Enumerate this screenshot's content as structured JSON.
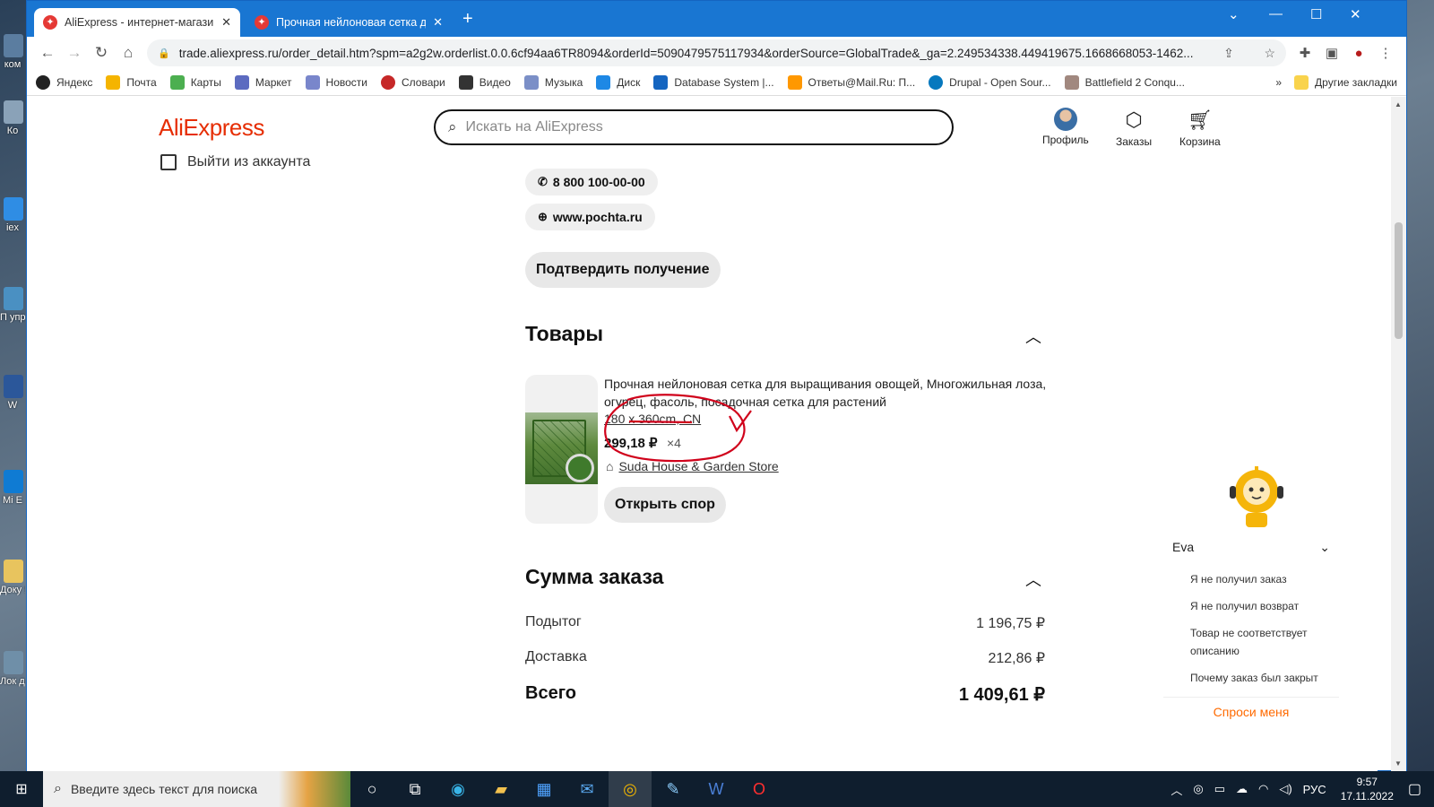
{
  "desktop": {
    "icons": [
      "ком",
      "Ко",
      "iex",
      "П упра",
      "W",
      "Mi E",
      "Доку Я",
      "Лок дис"
    ]
  },
  "browser": {
    "tabs": [
      {
        "title": "AliExpress - интернет-магазин э",
        "active": true
      },
      {
        "title": "Прочная нейлоновая сетка для",
        "active": false
      }
    ],
    "url": "trade.aliexpress.ru/order_detail.htm?spm=a2g2w.orderlist.0.0.6cf94aa6TR8094&orderId=5090479575117934&orderSource=GlobalTrade&_ga=2.249534338.449419675.1668668053-1462...",
    "bookmarks": [
      "Яндекс",
      "Почта",
      "Карты",
      "Маркет",
      "Новости",
      "Словари",
      "Видео",
      "Музыка",
      "Диск",
      "Database System |...",
      "Ответы@Mail.Ru: П...",
      "Drupal - Open Sour...",
      "Battlefield 2 Conqu..."
    ],
    "other_bookmarks": "Другие закладки"
  },
  "site": {
    "logo": "AliExpress",
    "logout": "Выйти из аккаунта",
    "search_placeholder": "Искать на AliExpress",
    "nav": {
      "profile": "Профиль",
      "orders": "Заказы",
      "cart": "Корзина"
    }
  },
  "delivery": {
    "phone": "8 800 100-00-00",
    "website": "www.pochta.ru",
    "confirm_button": "Подтвердить получение"
  },
  "products": {
    "heading": "Товары",
    "item": {
      "title": "Прочная нейлоновая сетка для выращивания овощей, Многожильная лоза, огурец, фасоль, посадочная сетка для растений",
      "variant": "180 x 360cm, CN",
      "price": "299,18 ₽",
      "qty": "×4",
      "store": "Suda House & Garden Store",
      "dispute_button": "Открыть спор"
    }
  },
  "summary": {
    "heading": "Сумма заказа",
    "rows": [
      {
        "label": "Подытог",
        "value": "1 196,75 ₽"
      },
      {
        "label": "Доставка",
        "value": "212,86 ₽"
      }
    ],
    "total_label": "Всего",
    "total_value": "1 409,61 ₽"
  },
  "assistant": {
    "name": "Eva",
    "options": [
      "Я не получил заказ",
      "Я не получил возврат",
      "Товар не соответствует описанию",
      "Почему заказ был закрыт"
    ],
    "ask": "Спроси меня"
  },
  "taskbar": {
    "search_placeholder": "Введите здесь текст для поиска",
    "lang": "РУС",
    "time": "9:57",
    "date": "17.11.2022"
  },
  "colors": {
    "accent": "#e62e04",
    "tab_bar": "#1976d2",
    "annotation": "#d0021b",
    "assistant_link": "#ff6a00"
  }
}
